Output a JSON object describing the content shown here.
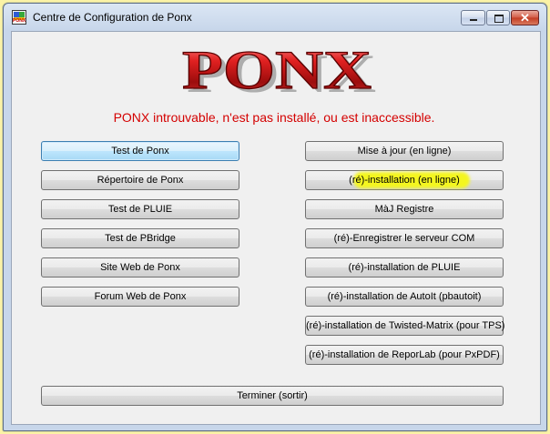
{
  "window": {
    "title": "Centre de Configuration de Ponx",
    "icon": "ponx-app-icon",
    "icon_label": "PONX"
  },
  "logo": {
    "text": "PONX",
    "color": "#d21f1f"
  },
  "status": {
    "message": "PONX introuvable, n'est pas installé, ou est inaccessible.",
    "color": "#d40000"
  },
  "left_buttons": [
    {
      "label": "Test de Ponx"
    },
    {
      "label": "Répertoire de Ponx"
    },
    {
      "label": "Test de PLUIE"
    },
    {
      "label": "Test de PBridge"
    },
    {
      "label": "Site Web de Ponx"
    },
    {
      "label": "Forum Web de Ponx"
    }
  ],
  "right_buttons": [
    {
      "label": "Mise à jour (en ligne)"
    },
    {
      "label": "(ré)-installation (en ligne)"
    },
    {
      "label": "MàJ Registre"
    },
    {
      "label": "(ré)-Enregistrer le serveur COM"
    },
    {
      "label": "(ré)-installation de PLUIE"
    },
    {
      "label": "(ré)-installation de AutoIt (pbautoit)"
    },
    {
      "label": "(ré)-installation de Twisted-Matrix (pour TPS)"
    },
    {
      "label": "(ré)-installation de ReporLab (pour PxPDF)"
    }
  ],
  "footer": {
    "quit_label": "Terminer (sortir)"
  },
  "colors": {
    "highlight": "#f4f61f",
    "desktop_background": "#fbf3a6"
  }
}
